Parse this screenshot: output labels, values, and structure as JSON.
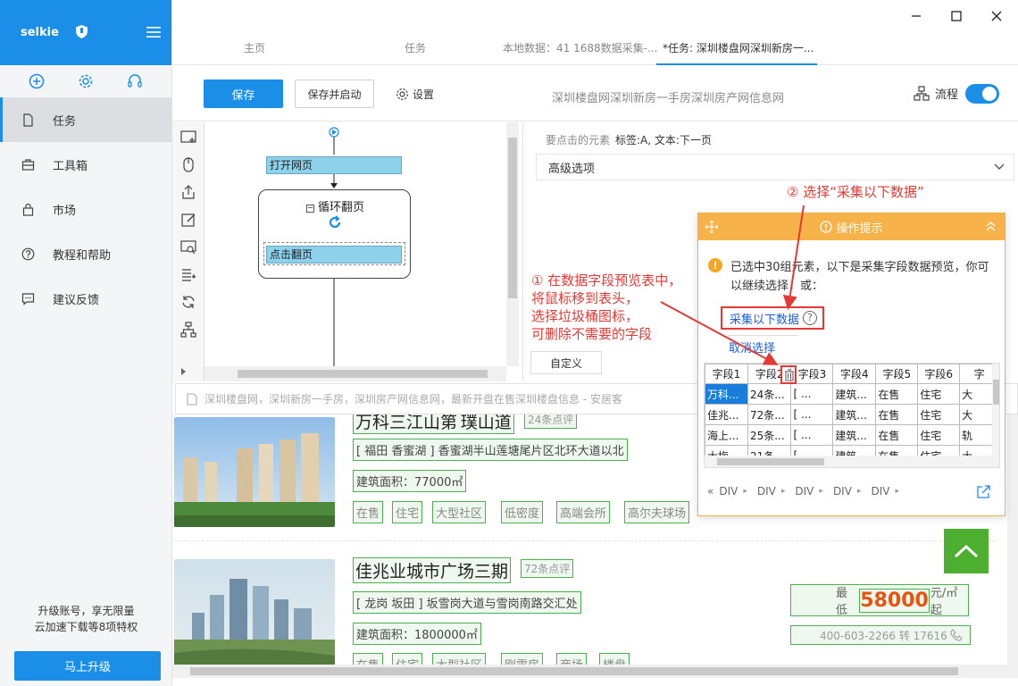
{
  "sidebar": {
    "brand": "selkie",
    "items": [
      {
        "label": "任务"
      },
      {
        "label": "工具箱"
      },
      {
        "label": "市场"
      },
      {
        "label": "教程和帮助"
      },
      {
        "label": "建议反馈"
      }
    ],
    "upsell_line1": "升级账号，享无限量",
    "upsell_line2": "云加速下载等8项特权",
    "upgrade_button": "马上升级"
  },
  "tabs": [
    {
      "label": "主页"
    },
    {
      "label": "任务"
    },
    {
      "label": "本地数据：41 1688数据采集-..."
    },
    {
      "label": "*任务: 深圳楼盘网深圳新房一..."
    }
  ],
  "toolbar": {
    "save": "保存",
    "save_start": "保存并启动",
    "settings": "设置",
    "task_title": "深圳楼盘网深圳新房一手房深圳房产网信息网",
    "flow": "流程"
  },
  "flow": {
    "open_page": "打开网页",
    "loop": "循环翻页",
    "click_page": "点击翻页"
  },
  "props": {
    "element_label": "要点击的元素",
    "element_value": "标签:A, 文本:下一页",
    "advanced": "高级选项",
    "custom": "自定义"
  },
  "browser": {
    "url": "深圳楼盘网，深圳新房一手房，深圳房产网信息网，最新开盘在售深圳楼盘信息 - 安居客"
  },
  "listings": [
    {
      "title": "万科三江山第 璞山道",
      "count": "24条点评",
      "address": "[ 福田 香蜜湖 ] 香蜜湖半山莲塘尾片区北环大道以北",
      "area": "建筑面积：77000㎡",
      "tags": [
        "在售",
        "住宅",
        "大型社区",
        "低密度",
        "高端会所",
        "高尔夫球场"
      ]
    },
    {
      "title": "佳兆业城市广场三期",
      "count": "72条点评",
      "address": "[ 龙岗 坂田 ] 坂雪岗大道与雪岗南路交汇处",
      "area": "建筑面积：1800000㎡",
      "tags": [
        "在售",
        "住宅",
        "大型社区",
        "刚需房",
        "商场",
        "楼盘"
      ],
      "price_prefix": "最低",
      "price": "58000",
      "price_suffix": "元/㎡起",
      "phone": "400-603-2266 转 17616"
    }
  ],
  "tip": {
    "title": "操作提示",
    "message": "已选中30组元素，以下是采集字段数据预览，你可以继续选择，或：",
    "collect": "采集以下数据",
    "cancel": "取消选择",
    "columns": [
      "字段1",
      "字段2",
      "字段3",
      "字段4",
      "字段5",
      "字段6",
      "字"
    ],
    "rows": [
      [
        "万科...",
        "24条...",
        "[ ...",
        "建筑...",
        "在售",
        "住宅",
        "大"
      ],
      [
        "佳兆...",
        "72条...",
        "[ ...",
        "建筑...",
        "在售",
        "住宅",
        "大"
      ],
      [
        "海上...",
        "25条...",
        "[ ...",
        "建筑...",
        "在售",
        "住宅",
        "轨"
      ],
      [
        "大梅...",
        "21条...",
        "[ ...",
        "建筑...",
        "在售",
        "住宅",
        "大"
      ]
    ],
    "crumbs": [
      "DIV",
      "DIV",
      "DIV",
      "DIV",
      "DIV"
    ]
  },
  "annotations": {
    "step1_l1": "① 在数据字段预览表中，",
    "step1_l2": "将鼠标移到表头，",
    "step1_l3": "选择垃圾桶图标，",
    "step1_l4": "可删除不需要的字段",
    "step2": "② 选择“采集以下数据”"
  },
  "colors": {
    "accent": "#1b8fe8",
    "tip_header": "#f7b24a",
    "annotation": "#e53935",
    "price": "#e8540f",
    "scroll_top": "#4caf2f"
  }
}
